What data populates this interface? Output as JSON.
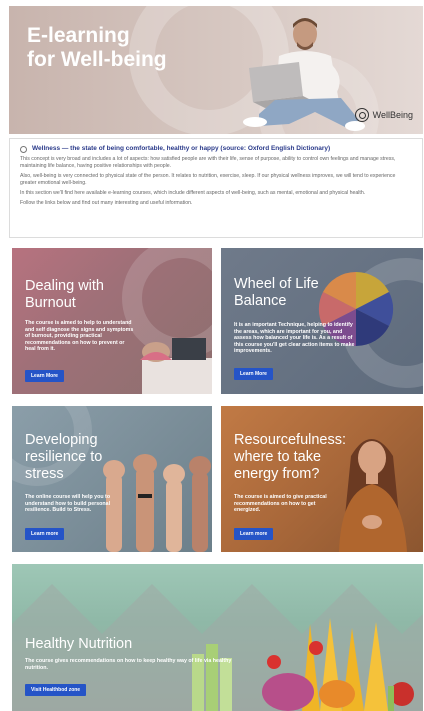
{
  "hero": {
    "title_line1": "E-learning",
    "title_line2": "for Well-being",
    "logo_text": "WellBeing"
  },
  "info": {
    "headline": "Wellness — the state of being comfortable, healthy or happy (source: Oxford English Dictionary)",
    "paragraphs": [
      "This concept is very broad and includes a lot of aspects: how satisfied people are with their life, sense of purpose, ability to control own feelings and manage stress, maintaining life balance, having positive relationships with people.",
      "Also, well-being is very connected to physical state of the person. It relates to nutrition, exercise, sleep. If our physical wellness improves, we will tend to experience greater emotional well-being.",
      "In this section we'll find here available e-learning courses, which include different aspects of well-being, such as mental, emotional and physical health.",
      "Follow the links below and find out many interesting and useful information."
    ]
  },
  "cards": [
    {
      "title_line1": "Dealing with",
      "title_line2": "Burnout",
      "desc": "The course is aimed to help to understand and self diagnose the signs and symptoms of burnout, providing practical recommendations on how to prevent or heal from it.",
      "button": "Learn More"
    },
    {
      "title_line1": "Wheel of Life",
      "title_line2": "Balance",
      "desc": "It is an important Technique, helping to identify the areas, which are important for you, and assess how balanced your life is. As a result of this course you'll get clear action items to make improvements.",
      "button": "Learn More"
    },
    {
      "title_line1": "Developing",
      "title_line2": "resilience to",
      "title_line3": "stress",
      "desc": "The online course will help you to understand how to build personal resilience. Build to Stress.",
      "button": "Learn more"
    },
    {
      "title_line1": "Resourcefulness:",
      "title_line2": "where to take",
      "title_line3": "energy from?",
      "desc": "The course is aimed to give practical recommendations on how to get energized.",
      "button": "Learn more"
    },
    {
      "title_line1": "Healthy Nutrition",
      "desc": "The course gives recommendations on how to keep healthy way of life via healthy nutrition.",
      "button": "Visit Healthbod zone"
    }
  ],
  "colors": {
    "button": "#2554c7",
    "info_headline": "#2a3a8a"
  }
}
